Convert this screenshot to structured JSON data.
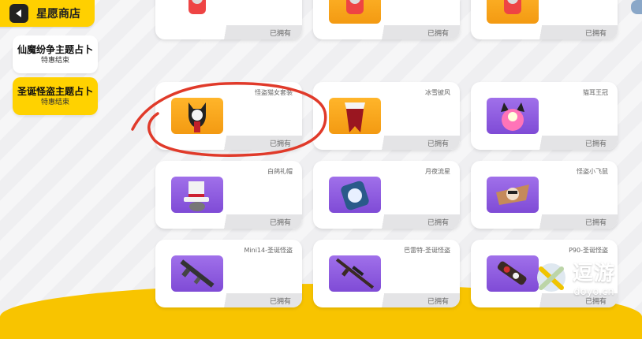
{
  "header": {
    "title": "星愿商店"
  },
  "sidebar": {
    "items": [
      {
        "name": "仙魔纷争主题占卜",
        "sub": "特惠结束",
        "active": false
      },
      {
        "name": "圣诞怪盗主题占卜",
        "sub": "特惠结束",
        "active": true
      }
    ]
  },
  "grid": {
    "owned_label": "已拥有",
    "rows": [
      [
        {
          "name": "",
          "color": "pink",
          "icon": "hero-icon"
        },
        {
          "name": "",
          "color": "orange",
          "icon": "hero-icon"
        },
        {
          "name": "",
          "color": "orange",
          "icon": "hero-icon"
        }
      ],
      [
        {
          "name": "怪盗猫女套装",
          "color": "orange",
          "icon": "cat-thief-outfit-icon"
        },
        {
          "name": "冰雪披风",
          "color": "orange",
          "icon": "cape-icon"
        },
        {
          "name": "猫耳王冠",
          "color": "purple",
          "icon": "cat-ear-crown-icon"
        }
      ],
      [
        {
          "name": "白鸽礼帽",
          "color": "purple",
          "icon": "top-hat-icon"
        },
        {
          "name": "月夜流星",
          "color": "purple",
          "icon": "meteor-card-icon"
        },
        {
          "name": "怪盗小飞鼠",
          "color": "purple",
          "icon": "flying-squirrel-icon"
        }
      ],
      [
        {
          "name": "Mini14-圣诞怪盗",
          "color": "purple",
          "icon": "rifle-icon"
        },
        {
          "name": "巴雷特-圣诞怪盗",
          "color": "purple",
          "icon": "sniper-icon"
        },
        {
          "name": "P90-圣诞怪盗",
          "color": "purple",
          "icon": "smg-icon"
        }
      ]
    ]
  },
  "watermark": {
    "text": "逗游",
    "url": "doyo.cn"
  },
  "colors": {
    "accent": "#ffd000",
    "annotation": "#e03a2a"
  }
}
